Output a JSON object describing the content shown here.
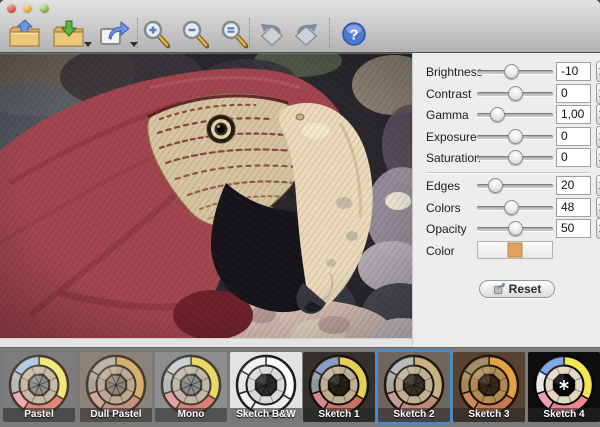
{
  "window": {
    "traffic_lights": [
      {
        "name": "close",
        "color": "#df4b40"
      },
      {
        "name": "minimize",
        "color": "#dfa83e"
      },
      {
        "name": "zoom",
        "color": "#7fb13f"
      }
    ]
  },
  "toolbar": {
    "buttons": [
      {
        "name": "open",
        "icon": "folder-up-arrow-icon",
        "has_menu": false
      },
      {
        "name": "save",
        "icon": "folder-down-arrow-icon",
        "has_menu": true
      },
      {
        "name": "export",
        "icon": "frame-out-arrow-icon",
        "has_menu": true
      },
      {
        "name": "zoom-in",
        "icon": "magnifier-plus-icon",
        "has_menu": false
      },
      {
        "name": "zoom-out",
        "icon": "magnifier-minus-icon",
        "has_menu": false
      },
      {
        "name": "zoom-actual",
        "icon": "magnifier-equal-icon",
        "has_menu": false
      },
      {
        "name": "rotate-left",
        "icon": "rotate-left-icon",
        "has_menu": false
      },
      {
        "name": "rotate-right",
        "icon": "rotate-right-icon",
        "has_menu": false
      },
      {
        "name": "help",
        "icon": "question-icon",
        "has_menu": false
      }
    ],
    "help_glyph": "?"
  },
  "adjustments": {
    "sliders": [
      {
        "label": "Brightness",
        "value": "-10",
        "pos": 45
      },
      {
        "label": "Contrast",
        "value": "0",
        "pos": 51
      },
      {
        "label": "Gamma",
        "value": "1,00",
        "pos": 27
      },
      {
        "label": "Exposure",
        "value": "0",
        "pos": 51
      },
      {
        "label": "Saturation",
        "value": "0",
        "pos": 51
      },
      {
        "label": "Edges",
        "value": "20",
        "pos": 24
      },
      {
        "label": "Colors",
        "value": "48",
        "pos": 46
      },
      {
        "label": "Opacity",
        "value": "50",
        "pos": 51
      }
    ],
    "color_row": {
      "label": "Color",
      "swatch": "#e2a25e"
    },
    "reset_label": "Reset"
  },
  "canvas": {
    "subject": "red-macaw-head-sketch-effect-preview"
  },
  "presets": {
    "selected": "Sketch 2",
    "selection_color": "#3f8fd8",
    "items": [
      {
        "label": "Pastel",
        "bg": "#7d7d7d",
        "y": "#f0e87c",
        "r": "#e08578",
        "p": "#eaacb2",
        "g": "#b2bcbc",
        "b": "#a4c4e4",
        "mid": "#c6baa4",
        "center": "#8e8e8e",
        "outline": "#4a382e",
        "star": false,
        "selected": false
      },
      {
        "label": "Dull Pastel",
        "bg": "#8b8377",
        "y": "#d4b172",
        "r": "#c68f7e",
        "p": "#cfa897",
        "g": "#a8a499",
        "b": "#b0ada2",
        "mid": "#bcab92",
        "center": "#8d8679",
        "outline": "#4a382e",
        "star": false,
        "selected": false
      },
      {
        "label": "Mono",
        "bg": "#8e8e8e",
        "y": "#ead967",
        "r": "#d68276",
        "p": "#dfa3a3",
        "g": "#b3bbb9",
        "b": "#c1cbcb",
        "mid": "#c2b7a7",
        "center": "#898989",
        "outline": "#473c32",
        "star": false,
        "selected": false
      },
      {
        "label": "Sketch B&W",
        "bg": "#e3e3e3",
        "y": "#fafafa",
        "r": "#ededed",
        "p": "#f2f2f2",
        "g": "#e7e7e7",
        "b": "#f0f0f0",
        "mid": "#d9d9d9",
        "center": "#2e2e2e",
        "outline": "#1c1c1c",
        "star": false,
        "selected": false
      },
      {
        "label": "Sketch 1",
        "bg": "#34302c",
        "y": "#e6cf58",
        "r": "#c87266",
        "p": "#d2888c",
        "g": "#8d97a0",
        "b": "#7890bc",
        "mid": "#bfae92",
        "center": "#29231d",
        "outline": "#14100c",
        "star": false,
        "selected": false
      },
      {
        "label": "Sketch 2",
        "bg": "#6f675f",
        "y": "#cbb083",
        "r": "#bf897b",
        "p": "#c79b93",
        "g": "#a7a7a3",
        "b": "#afb3b7",
        "mid": "#bfae92",
        "center": "#393129",
        "outline": "#1e1810",
        "star": false,
        "selected": true
      },
      {
        "label": "Sketch 3",
        "bg": "#564431",
        "y": "#e0a244",
        "r": "#ca794e",
        "p": "#cb8961",
        "g": "#a6875c",
        "b": "#997e55",
        "mid": "#b08a50",
        "center": "#392b1b",
        "outline": "#1f1307",
        "star": false,
        "selected": false
      },
      {
        "label": "Sketch 4",
        "bg": "#0e0e10",
        "y": "#f1e553",
        "r": "#ef8391",
        "p": "#efa0af",
        "g": "#e9e9e9",
        "b": "#6d9be5",
        "mid": "#e5d8c2",
        "center": "#0a0a0a",
        "outline": "#050505",
        "star": true,
        "selected": false
      }
    ]
  }
}
